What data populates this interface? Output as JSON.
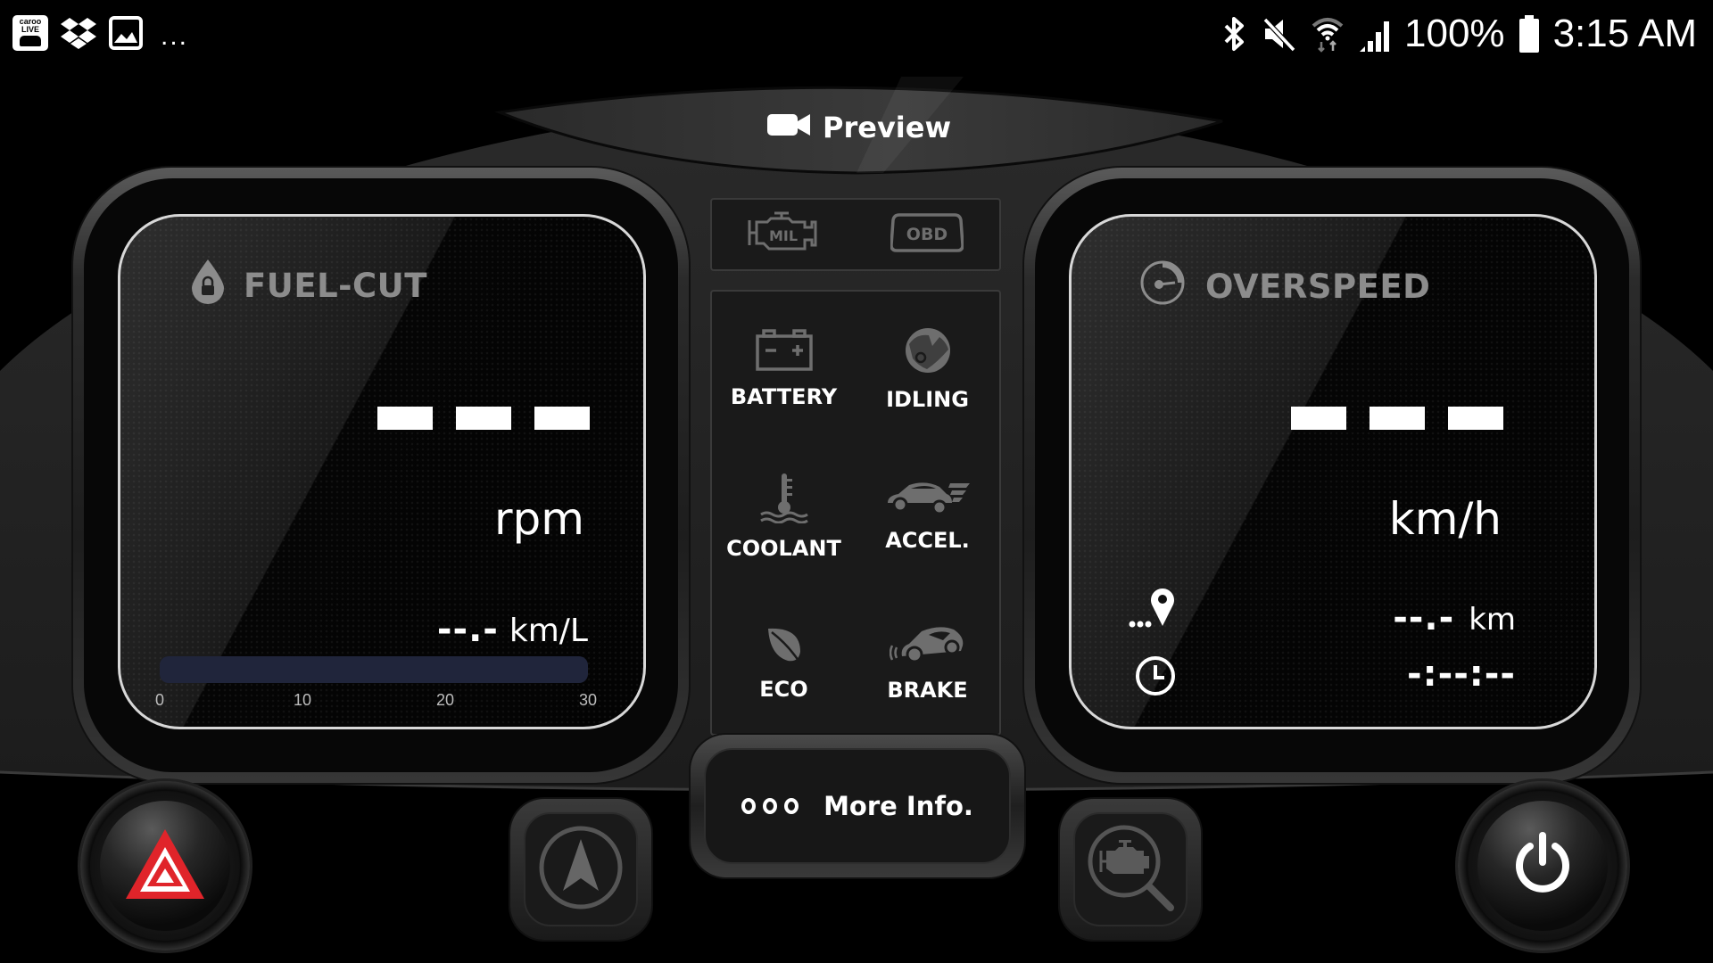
{
  "status_bar": {
    "notification_icons": [
      {
        "name": "caroo-live-app-icon",
        "text_line1": "caroo",
        "text_line2": "LIVE"
      },
      {
        "name": "dropbox-icon"
      },
      {
        "name": "gallery-icon"
      }
    ],
    "more_notifications": "...",
    "system_icons": [
      "bluetooth-icon",
      "mute-icon",
      "wifi-icon",
      "signal-icon"
    ],
    "battery_percent": "100%",
    "time": "3:15 AM"
  },
  "header": {
    "preview_label": "Preview"
  },
  "left_gauge": {
    "title": "FUEL-CUT",
    "main_value": "---",
    "main_unit": "rpm",
    "economy_value": "--.-",
    "economy_unit": "km/L",
    "fuel_bar": {
      "value_fraction": 0,
      "ticks": [
        "0",
        "10",
        "20",
        "30"
      ],
      "range": [
        0,
        30
      ]
    }
  },
  "right_gauge": {
    "title": "OVERSPEED",
    "main_value": "---",
    "main_unit": "km/h",
    "distance_value": "--.-",
    "distance_unit": "km",
    "time_value": "-:--:--"
  },
  "center_panel": {
    "top_indicators": [
      {
        "name": "mil-check-engine",
        "label": "MIL"
      },
      {
        "name": "obd",
        "label": "OBD"
      }
    ],
    "warnings": [
      {
        "key": "battery",
        "label": "BATTERY"
      },
      {
        "key": "idling",
        "label": "IDLING"
      },
      {
        "key": "coolant",
        "label": "COOLANT"
      },
      {
        "key": "accel",
        "label": "ACCEL."
      },
      {
        "key": "eco",
        "label": "ECO"
      },
      {
        "key": "brake",
        "label": "BRAKE"
      }
    ]
  },
  "bottom_bar": {
    "hazard_button": "hazard",
    "navigation_button": "navigation",
    "more_info_label": "More Info.",
    "engine_diagnosis_button": "engine-diagnosis",
    "power_button": "power"
  },
  "colors": {
    "hazard_red": "#e0242a",
    "icon_gray": "#6e6e6e",
    "fuel_bar_track": "#20253b",
    "title_gray": "#8c8c8c"
  }
}
